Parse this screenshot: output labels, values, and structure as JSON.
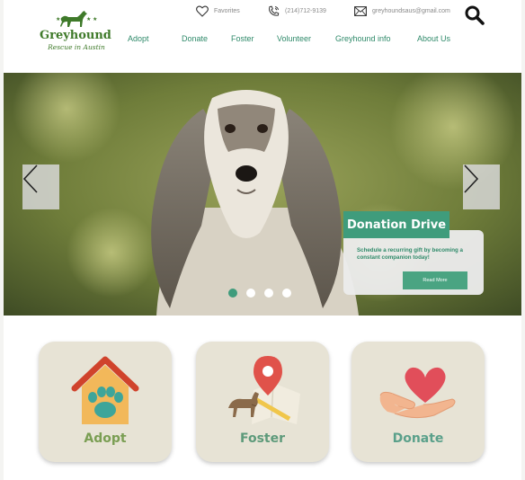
{
  "brand": {
    "name": "Greyhound",
    "subtitle": "Rescue in Austin",
    "primary_color": "#3f9c7c",
    "logo_color": "#3f7a2a"
  },
  "utility_bar": {
    "favorites_label": "Favorites",
    "phone": "(214)712-9139",
    "email": "greyhoundsaus@gmail.com",
    "search_icon": "search-icon"
  },
  "nav": {
    "items": [
      "Adopt",
      "Donate",
      "Foster",
      "Volunteer",
      "Greyhound info",
      "About Us"
    ]
  },
  "hero": {
    "slide_count": 4,
    "active_slide": 1,
    "card": {
      "title": "Donation Drive",
      "text": "Schedule a recurring gift by becoming a constant companion today!",
      "button": "Read More"
    }
  },
  "tiles": [
    {
      "label": "Adopt",
      "icon": "house-paw-icon",
      "color": "#7a9e53"
    },
    {
      "label": "Foster",
      "icon": "dog-map-pin-icon",
      "color": "#5d9a7a"
    },
    {
      "label": "Donate",
      "icon": "hand-heart-icon",
      "color": "#5aa08a"
    }
  ]
}
